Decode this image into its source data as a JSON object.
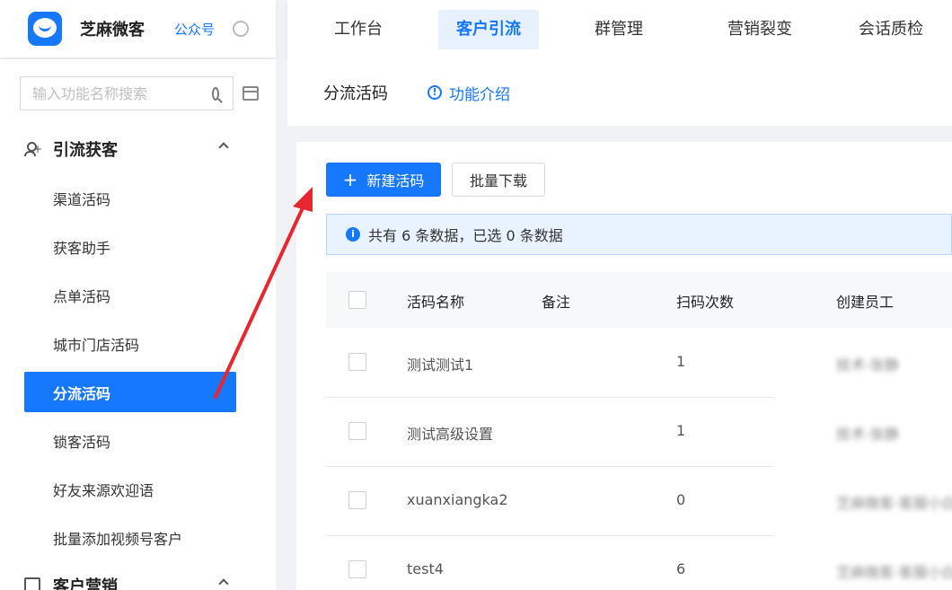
{
  "header": {
    "brand": "芝麻微客",
    "public_account": "公众号",
    "nav_tabs": [
      "工作台",
      "客户引流",
      "群管理",
      "营销裂变",
      "会话质检"
    ],
    "active_tab": "客户引流"
  },
  "sidebar": {
    "search_placeholder": "输入功能名称搜索",
    "group1": {
      "label": "引流获客",
      "icon": "user-plus-icon"
    },
    "items": [
      "渠道活码",
      "获客助手",
      "点单活码",
      "城市门店活码",
      "分流活码",
      "锁客活码",
      "好友来源欢迎语",
      "批量添加视频号客户"
    ],
    "active_item": "分流活码",
    "group2": {
      "label": "客户营销",
      "icon": "doc-icon"
    }
  },
  "page": {
    "title": "分流活码",
    "intro_link": "功能介绍",
    "new_button": "新建活码",
    "batch_download": "批量下载",
    "alert_text": "共有 6 条数据，已选 0 条数据"
  },
  "table": {
    "columns": [
      "活码名称",
      "备注",
      "扫码次数",
      "创建员工"
    ],
    "rows": [
      {
        "name": "测试测试1",
        "scans": "1",
        "creator": "技术-张静"
      },
      {
        "name": "测试高级设置",
        "scans": "1",
        "creator": "技术-张静"
      },
      {
        "name": "xuanxiangka2",
        "scans": "0",
        "creator": "芝麻微客-客服小白"
      },
      {
        "name": "test4",
        "scans": "6",
        "creator": "芝麻微客-客服小白"
      }
    ]
  },
  "colors": {
    "accent": "#1677ff",
    "annotation_arrow": "#e8262f"
  }
}
